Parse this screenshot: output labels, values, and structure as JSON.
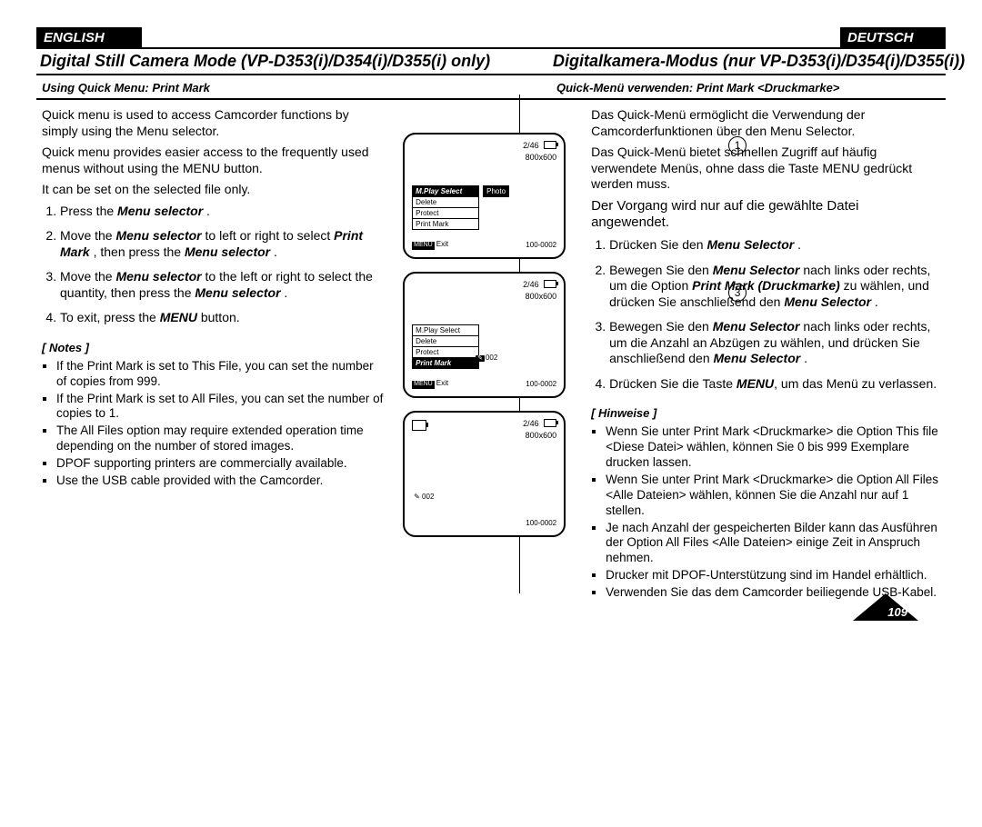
{
  "langbar": {
    "left": "ENGLISH",
    "right": "DEUTSCH"
  },
  "title": {
    "left": "Digital Still Camera Mode (VP-D353(i)/D354(i)/D355(i) only)",
    "right": "Digitalkamera-Modus (nur VP-D353(i)/D354(i)/D355(i))"
  },
  "subhead": {
    "left": "Using Quick Menu: Print Mark",
    "right": "Quick-Menü verwenden: Print Mark <Druckmarke>"
  },
  "left": {
    "intro1": "Quick menu is used to access Camcorder functions by simply using the Menu selector.",
    "intro2": "Quick menu provides easier access to the frequently used menus without using the MENU button.",
    "intro3": "It can be set on the selected file only.",
    "step1a": "Press the ",
    "step1b": "Menu selector",
    "step1c": " .",
    "step2a": "Move the ",
    "step2b": "Menu selector",
    "step2c": "  to left or right to select ",
    "step2d": "Print Mark",
    "step2e": " , then press the ",
    "step2f": "Menu selector",
    "step2g": " .",
    "step3a": "Move the ",
    "step3b": "Menu selector",
    "step3c": "  to the left or right to select the quantity, then press the ",
    "step3d": "Menu selector",
    "step3e": " .",
    "step4a": "To exit, press the ",
    "step4b": "MENU",
    "step4c": " button.",
    "noteshead": "[ Notes ]",
    "n1": "If the Print Mark is set to This File, you can set the number of copies from 999.",
    "n2": "If the Print Mark is set to All Files, you can set the number of copies to 1.",
    "n3": "The All Files option may require extended operation time depending on the number of stored images.",
    "n4": "DPOF supporting printers are commercially available.",
    "n5": "Use the USB cable provided with the Camcorder."
  },
  "right": {
    "intro1": "Das Quick-Menü ermöglicht die Verwendung der Camcorderfunktionen über den Menu Selector.",
    "intro2": "Das Quick-Menü bietet schnellen Zugriff auf häufig verwendete Menüs, ohne dass die Taste MENU gedrückt werden muss.",
    "intro3": "Der Vorgang wird nur auf die gewählte Datei angewendet.",
    "step1a": "Drücken Sie den ",
    "step1b": "Menu Selector",
    "step1c": " .",
    "step2a": "Bewegen Sie den ",
    "step2b": "Menu Selector",
    "step2c": "  nach links oder rechts, um die Option ",
    "step2d": "Print Mark (Druckmarke)",
    "step2e": "  zu wählen, und drücken Sie anschließend den ",
    "step2f": "Menu Selector",
    "step2g": " .",
    "step3a": "Bewegen Sie den ",
    "step3b": "Menu Selector",
    "step3c": "  nach links oder rechts, um die Anzahl an Abzügen zu wählen, und drücken Sie anschließend den ",
    "step3d": "Menu Selector",
    "step3e": " .",
    "step4a": "Drücken Sie die Taste ",
    "step4b": "MENU",
    "step4c": ", um das Menü zu verlassen.",
    "noteshead": "[ Hinweise ]",
    "n1": "Wenn Sie unter Print Mark <Druckmarke> die Option This file <Diese Datei> wählen, können Sie 0 bis 999 Exemplare drucken lassen.",
    "n2": "Wenn Sie unter Print Mark <Druckmarke> die Option All Files <Alle Dateien> wählen, können Sie die Anzahl nur auf 1 stellen.",
    "n3": "Je nach Anzahl der gespeicherten Bilder kann das Ausführen der Option All Files <Alle Dateien> einige Zeit in Anspruch nehmen.",
    "n4": "Drucker mit DPOF-Unterstützung sind im Handel erhältlich.",
    "n5": "Verwenden Sie das dem Camcorder beiliegende USB-Kabel."
  },
  "screens": {
    "counter": "2/46",
    "res": "800x600",
    "file": "100-0002",
    "exit": "Exit",
    "menu_label": "MENU",
    "items": {
      "m1": "M.Play Select",
      "m2": "Delete",
      "m3": "Protect",
      "m4": "Print Mark"
    },
    "s1_sel_val": "Photo",
    "s3_val": "002",
    "circ1": "1",
    "circ3": "3"
  },
  "pagenum": "109"
}
